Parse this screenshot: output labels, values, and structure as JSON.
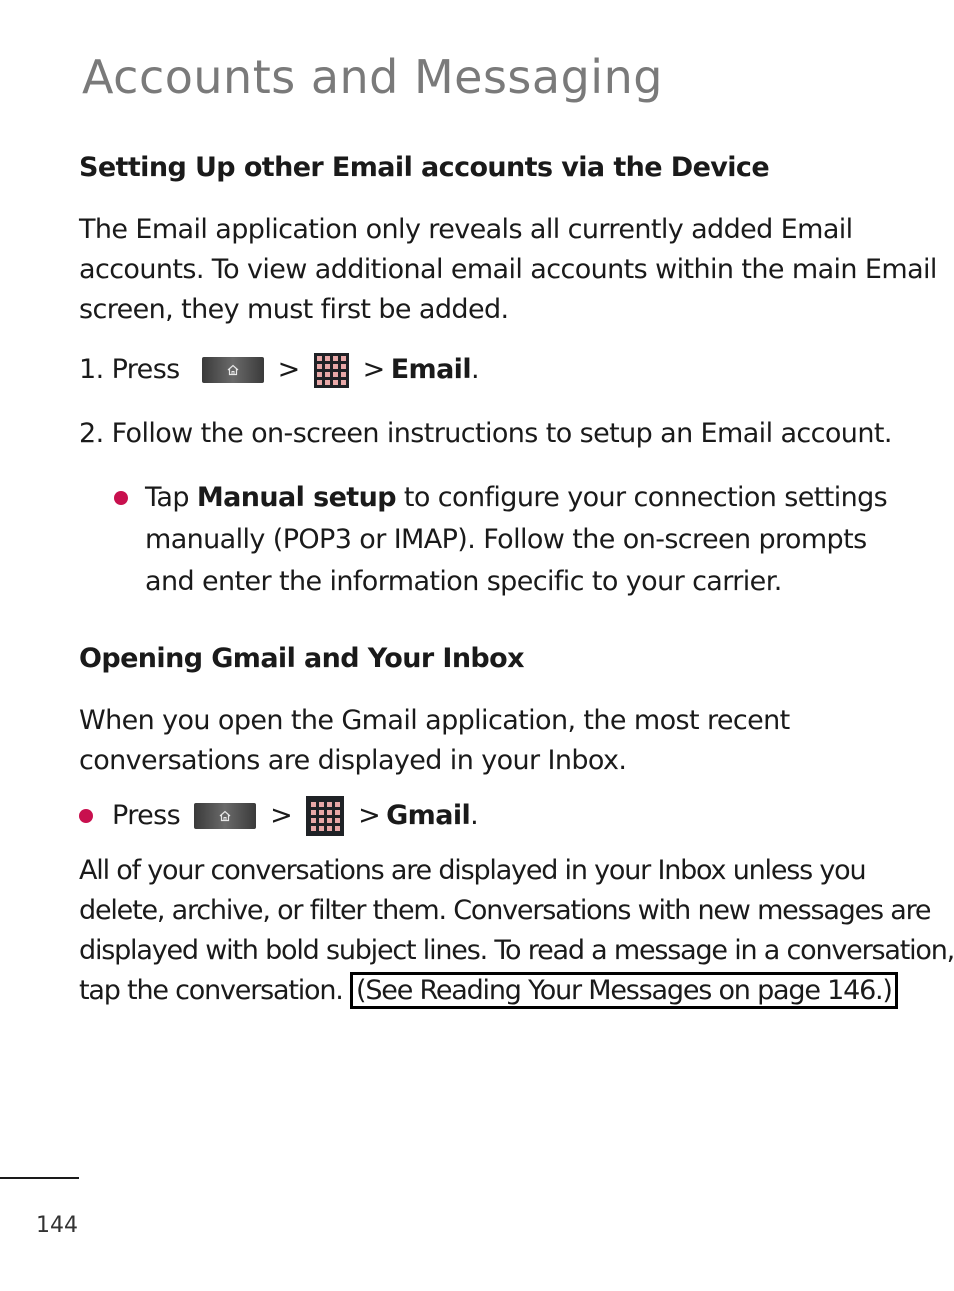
{
  "page_title": "Accounts and Messaging",
  "sections": [
    {
      "heading": "Setting Up other Email accounts via the Device",
      "intro_lines": [
        "The Email application only reveals all currently added Email",
        "accounts. To view additional email accounts within the main Email",
        "screen, they must first be added."
      ],
      "step1": {
        "number": "1.",
        "press_label": "Press",
        "separator": ">",
        "target": "Email",
        "period": "."
      },
      "step2": {
        "number": "2.",
        "text": "Follow the on-screen instructions to setup an Email account."
      },
      "bullet": {
        "prefix": "Tap ",
        "bold": "Manual setup",
        "line1_rest": " to configure your connection settings",
        "line2": "manually (POP3 or IMAP). Follow the on-screen prompts",
        "line3": "and enter the information specific to your carrier."
      }
    },
    {
      "heading": "Opening Gmail and Your Inbox",
      "intro_lines": [
        "When you open the Gmail application, the most recent",
        "conversations are displayed in your Inbox."
      ],
      "step": {
        "press_label": "Press",
        "separator": ">",
        "target": "Gmail",
        "period": "."
      },
      "body_lines": [
        "All of your conversations are displayed in your Inbox unless you",
        "delete, archive, or filter them. Conversations with new messages are",
        "displayed with bold subject lines. To read a message in a conversation,",
        "tap the conversation. "
      ],
      "xref": "(See Reading Your Messages on page 146.)"
    }
  ],
  "icons": {
    "home_key": "home-icon",
    "apps_key": "apps-grid-icon"
  },
  "colors": {
    "title": "#7a7a7a",
    "bullet": "#c8104e",
    "text": "#1a1a1a"
  },
  "page_number": "144"
}
